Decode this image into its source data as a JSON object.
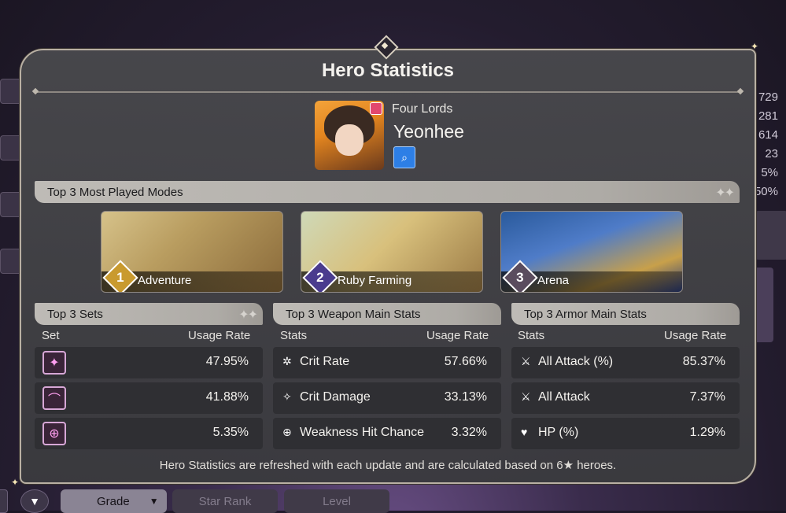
{
  "background": {
    "right_values": [
      "729",
      "281",
      "614",
      "23",
      "5%",
      "50%"
    ],
    "bottom_bar": {
      "grade_label": "Grade",
      "star_rank_label": "Star Rank",
      "level_label": "Level"
    }
  },
  "panel": {
    "title": "Hero Statistics",
    "hero": {
      "faction": "Four Lords",
      "name": "Yeonhee"
    },
    "modes_header": "Top 3 Most Played Modes",
    "modes": [
      {
        "rank": "1",
        "label": "Adventure"
      },
      {
        "rank": "2",
        "label": "Ruby Farming"
      },
      {
        "rank": "3",
        "label": "Arena"
      }
    ],
    "sets": {
      "header": "Top 3 Sets",
      "col_set": "Set",
      "col_rate": "Usage Rate",
      "rows": [
        {
          "icon": "crit-set-icon",
          "rate": "47.95%"
        },
        {
          "icon": "scythe-set-icon",
          "rate": "41.88%"
        },
        {
          "icon": "target-set-icon",
          "rate": "5.35%"
        }
      ]
    },
    "weapon": {
      "header": "Top 3 Weapon Main Stats",
      "col_stats": "Stats",
      "col_rate": "Usage Rate",
      "rows": [
        {
          "icon": "crit-rate-icon",
          "name": "Crit Rate",
          "rate": "57.66%"
        },
        {
          "icon": "crit-damage-icon",
          "name": "Crit Damage",
          "rate": "33.13%"
        },
        {
          "icon": "weakness-icon",
          "name": "Weakness Hit Chance",
          "rate": "3.32%"
        }
      ]
    },
    "armor": {
      "header": "Top 3 Armor Main Stats",
      "col_stats": "Stats",
      "col_rate": "Usage Rate",
      "rows": [
        {
          "icon": "attack-icon",
          "name": "All Attack (%)",
          "rate": "85.37%"
        },
        {
          "icon": "attack-icon",
          "name": "All Attack",
          "rate": "7.37%"
        },
        {
          "icon": "heart-icon",
          "name": "HP (%)",
          "rate": "1.29%"
        }
      ]
    },
    "footer": "Hero Statistics are refreshed with each update and are calculated based on 6★ heroes."
  }
}
